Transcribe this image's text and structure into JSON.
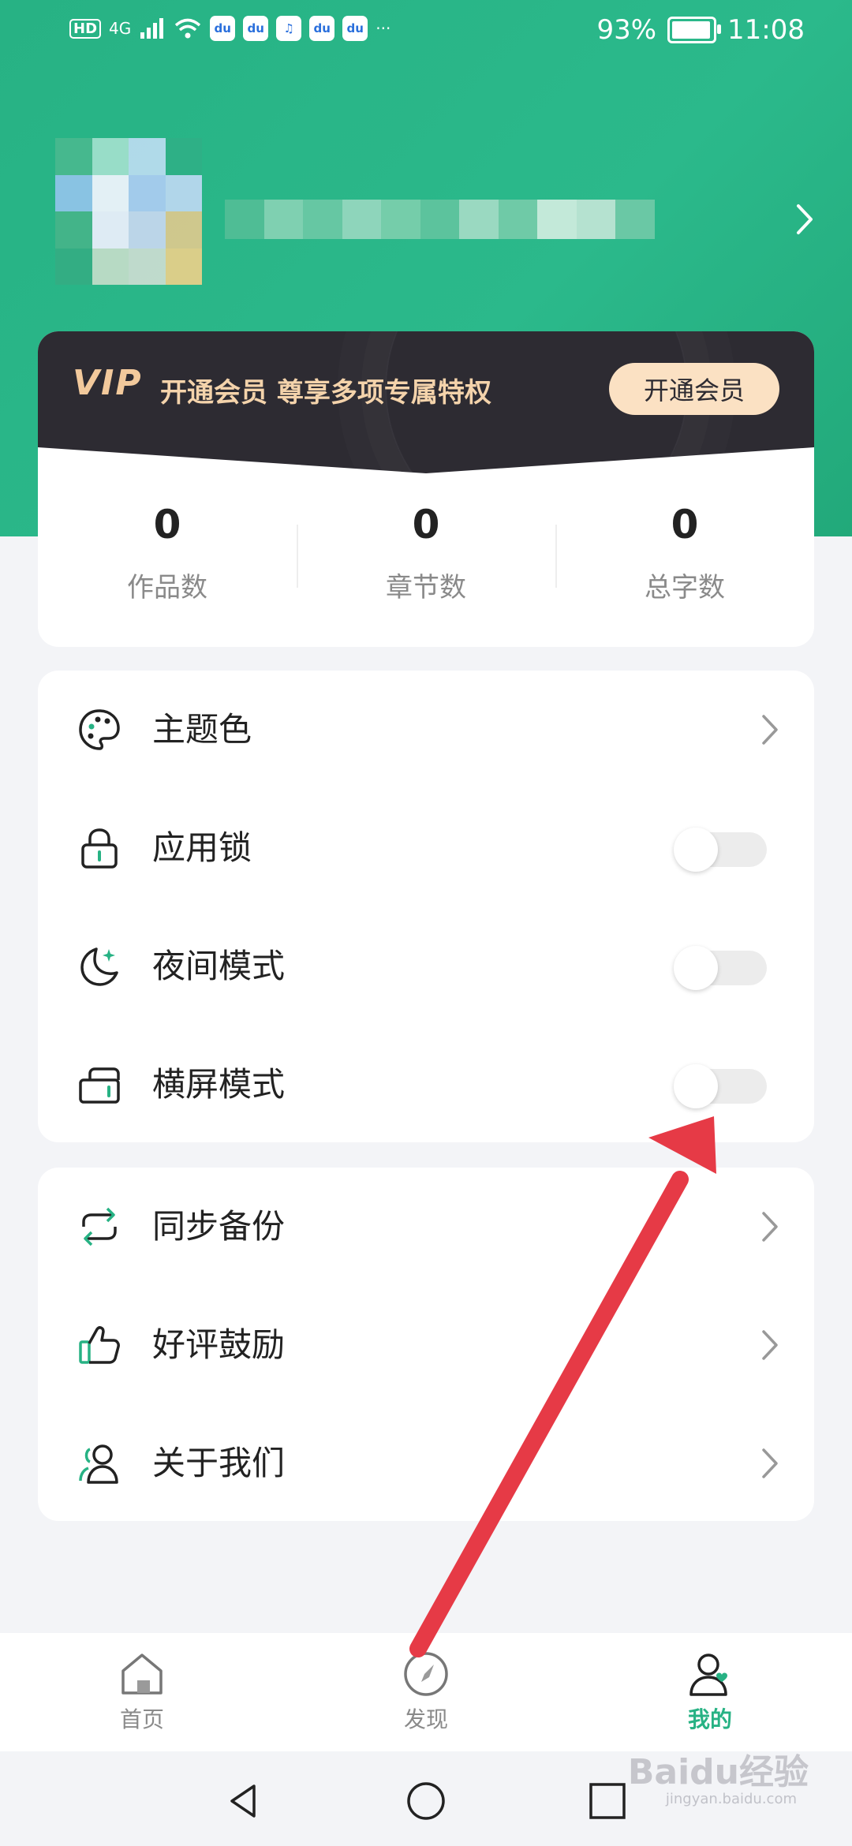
{
  "status_bar": {
    "left_labels": [
      "HD",
      "4G"
    ],
    "battery": "93%",
    "time": "11:08",
    "more": "···"
  },
  "vip": {
    "logo": "VIP",
    "text": "开通会员 尊享多项专属特权",
    "button": "开通会员"
  },
  "stats": [
    {
      "value": "0",
      "label": "作品数"
    },
    {
      "value": "0",
      "label": "章节数"
    },
    {
      "value": "0",
      "label": "总字数"
    }
  ],
  "settings": [
    {
      "label": "主题色",
      "icon": "palette-icon",
      "control": "chevron"
    },
    {
      "label": "应用锁",
      "icon": "lock-icon",
      "control": "toggle",
      "on": false
    },
    {
      "label": "夜间模式",
      "icon": "moon-icon",
      "control": "toggle",
      "on": false
    },
    {
      "label": "横屏模式",
      "icon": "landscape-icon",
      "control": "toggle",
      "on": false
    }
  ],
  "links": [
    {
      "label": "同步备份",
      "icon": "sync-icon"
    },
    {
      "label": "好评鼓励",
      "icon": "thumbs-up-icon"
    },
    {
      "label": "关于我们",
      "icon": "people-icon"
    }
  ],
  "tabs": [
    {
      "label": "首页",
      "icon": "home-icon",
      "active": false
    },
    {
      "label": "发现",
      "icon": "compass-icon",
      "active": false
    },
    {
      "label": "我的",
      "icon": "profile-heart-icon",
      "active": true
    }
  ],
  "watermark": {
    "main": "Baidu经验",
    "sub": "jingyan.baidu.com"
  },
  "colors": {
    "accent": "#27b284",
    "vip_dark": "#2d2b32",
    "vip_gold": "#f4d3ab",
    "annotation_arrow": "#e63a46"
  }
}
